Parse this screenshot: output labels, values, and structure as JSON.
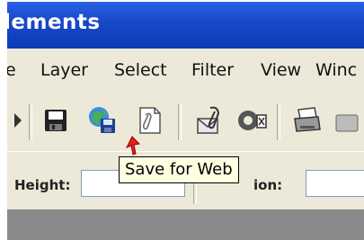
{
  "window": {
    "title": "lements"
  },
  "menu": {
    "items": [
      "e",
      "Layer",
      "Select",
      "Filter",
      "View",
      "Winc"
    ]
  },
  "toolbar": {
    "icons": [
      "partial-arrow-icon",
      "save-icon",
      "save-for-web-icon",
      "attach-file-icon",
      "attachment-icon",
      "settings-icon",
      "print-icon"
    ]
  },
  "options": {
    "height_label": "Height:",
    "height_value": "",
    "resolution_label": "ion:",
    "resolution_value": ""
  },
  "tooltip": {
    "text": "Save for Web"
  },
  "colors": {
    "titlebar": "#1849c9",
    "tooltip_bg": "#ffffe1",
    "cursor": "#e02020"
  }
}
